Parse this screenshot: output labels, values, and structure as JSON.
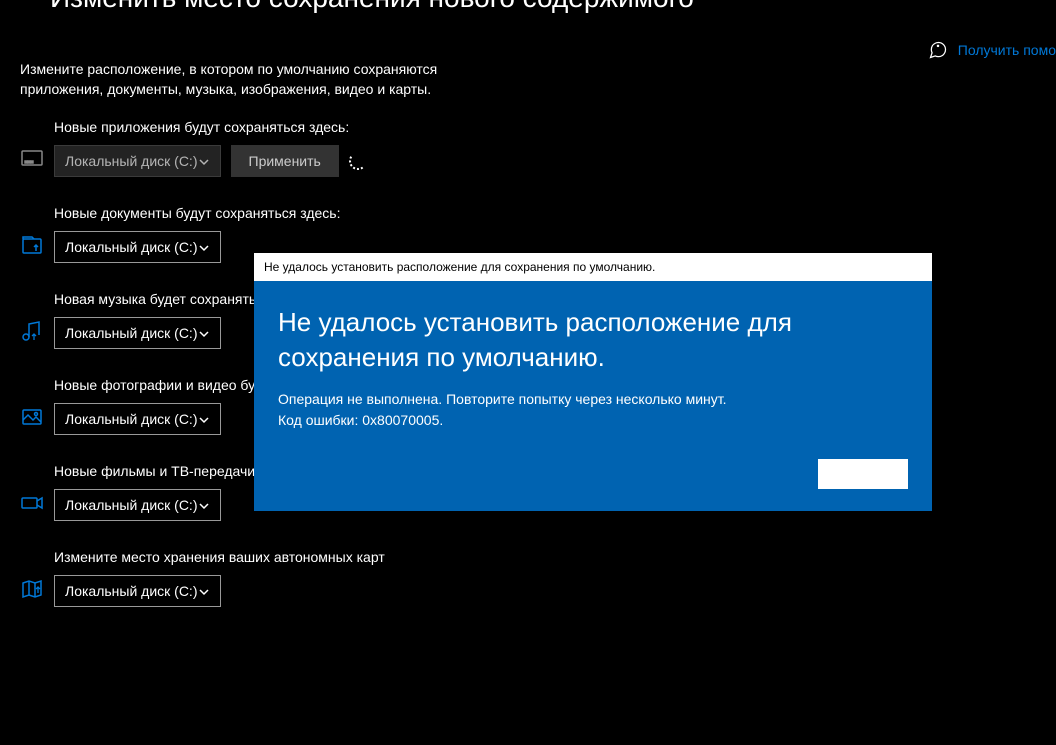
{
  "page": {
    "title": "Изменить место сохранения нового содержимого",
    "description": "Измените расположение, в котором по умолчанию сохраняются приложения, документы, музыка, изображения, видео и карты."
  },
  "help": {
    "label": "Получить помо"
  },
  "settings": [
    {
      "label": "Новые приложения будут сохраняться здесь:",
      "value": "Локальный диск (C:)",
      "apply_label": "Применить",
      "show_apply": true,
      "show_spinner": true,
      "disabled": true,
      "icon": "apps"
    },
    {
      "label": "Новые документы будут сохраняться здесь:",
      "value": "Локальный диск (C:)",
      "show_apply": false,
      "disabled": false,
      "icon": "documents"
    },
    {
      "label": "Новая музыка будет сохраняться",
      "value": "Локальный диск (C:)",
      "show_apply": false,
      "disabled": false,
      "icon": "music"
    },
    {
      "label": "Новые фотографии и видео буд",
      "value": "Локальный диск (C:)",
      "show_apply": false,
      "disabled": false,
      "icon": "photos"
    },
    {
      "label": "Новые фильмы и ТВ-передачи",
      "value": "Локальный диск (C:)",
      "show_apply": false,
      "disabled": false,
      "icon": "movies"
    },
    {
      "label": "Измените место хранения ваших автономных карт",
      "value": "Локальный диск (C:)",
      "show_apply": false,
      "disabled": false,
      "icon": "maps"
    }
  ],
  "dialog": {
    "titlebar": "Не удалось установить расположение для сохранения по умолчанию.",
    "heading": "Не удалось установить расположение для сохранения по умолчанию.",
    "message_line1": "Операция не выполнена. Повторите попытку через несколько минут.",
    "message_line2": "Код ошибки: 0x80070005.",
    "button": " "
  }
}
